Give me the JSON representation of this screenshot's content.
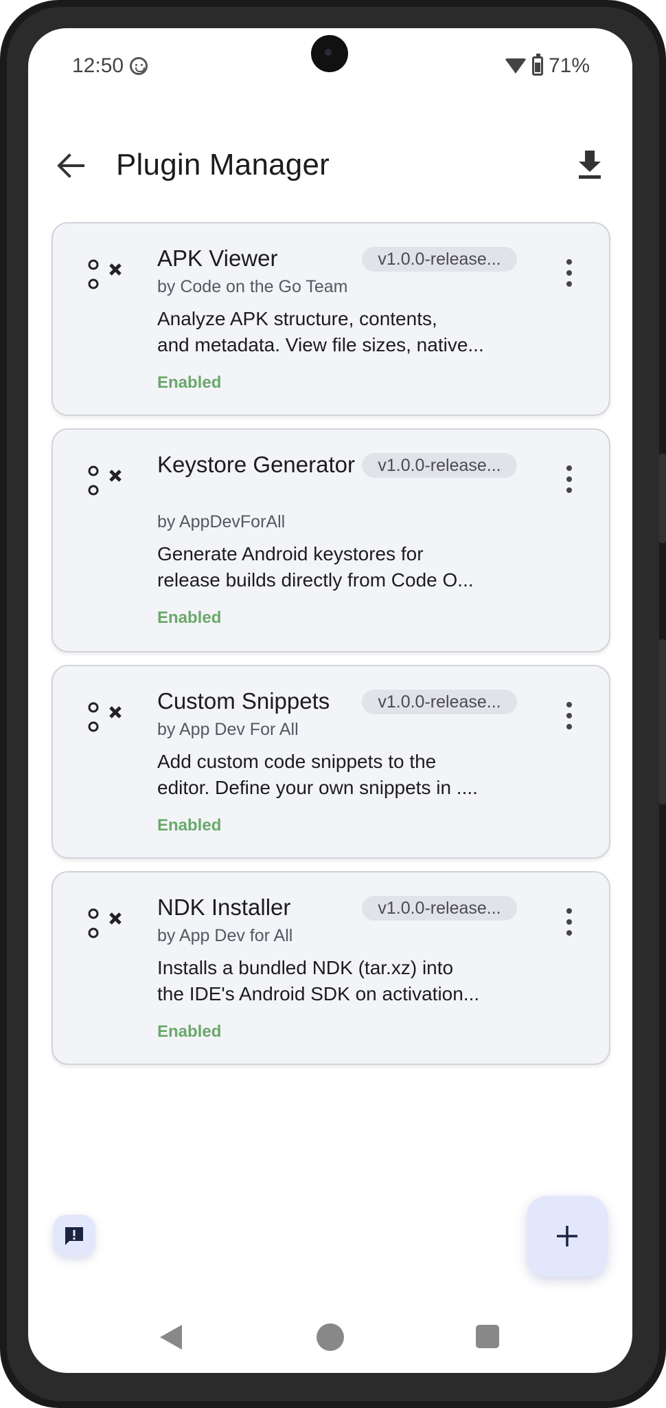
{
  "status_bar": {
    "time": "12:50",
    "battery": "71%"
  },
  "app_bar": {
    "title": "Plugin Manager"
  },
  "plugins": [
    {
      "name": "APK Viewer",
      "version": "v1.0.0-release...",
      "author": "by Code on the Go Team",
      "description_line1": "Analyze APK structure, contents,",
      "description_line2": "and metadata. View file sizes, native...",
      "status": "Enabled"
    },
    {
      "name": "Keystore Generator",
      "version": "v1.0.0-release...",
      "author": "by AppDevForAll",
      "description_line1": "Generate Android keystores for",
      "description_line2": "release builds directly from Code O...",
      "status": "Enabled"
    },
    {
      "name": "Custom Snippets",
      "version": "v1.0.0-release...",
      "author": "by App Dev For All",
      "description_line1": "Add custom code snippets to the",
      "description_line2": "editor. Define your own snippets in ....",
      "status": "Enabled"
    },
    {
      "name": "NDK Installer",
      "version": "v1.0.0-release...",
      "author": "by App Dev for All",
      "description_line1": "Installs a bundled NDK (tar.xz) into",
      "description_line2": "the IDE's Android SDK on activation...",
      "status": "Enabled"
    }
  ],
  "colors": {
    "enabled": "#6aa86a",
    "fab_bg": "#e3e7fb",
    "card_bg": "#f3f4f8"
  }
}
